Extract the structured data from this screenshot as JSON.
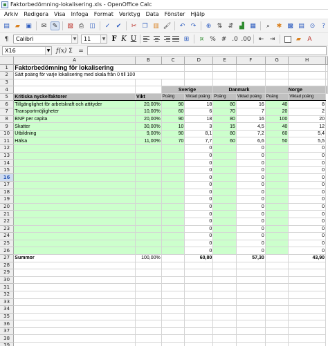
{
  "window": {
    "title": "Faktorbedömning-lokalisering.xls - OpenOffice Calc"
  },
  "menu": [
    "Arkiv",
    "Redigera",
    "Visa",
    "Infoga",
    "Format",
    "Verktyg",
    "Data",
    "Fönster",
    "Hjälp"
  ],
  "toolbar": {
    "font_name": "Calibri",
    "font_size": "11"
  },
  "formula_bar": {
    "cell_ref": "X16",
    "formula": ""
  },
  "columns": [
    "A",
    "B",
    "C",
    "D",
    "E",
    "F",
    "G",
    "H"
  ],
  "sheet": {
    "title": "Faktorbedömning för lokalisering",
    "subtitle": "Sätt poäng för varje lokalisering med skala från 0 till 100",
    "countries": [
      "Sverige",
      "Danmark",
      "Norge"
    ],
    "header": {
      "factor": "Kritiska nyckelfaktorer",
      "weight": "Vikt",
      "points": "Poäng",
      "weighted": "Viktad poäng"
    },
    "rows": [
      {
        "factor": "Tillgänglighet för arbetskraft och attityder",
        "weight": "20,00%",
        "vals": [
          "90",
          "18",
          "80",
          "16",
          "40",
          "8"
        ]
      },
      {
        "factor": "Transportmöjligheter",
        "weight": "10,00%",
        "vals": [
          "60",
          "6",
          "70",
          "7",
          "20",
          "2"
        ]
      },
      {
        "factor": "BNP per capita",
        "weight": "20,00%",
        "vals": [
          "90",
          "18",
          "80",
          "16",
          "100",
          "20"
        ]
      },
      {
        "factor": "Skatter",
        "weight": "30,00%",
        "vals": [
          "10",
          "3",
          "15",
          "4,5",
          "40",
          "12"
        ]
      },
      {
        "factor": "Utbildning",
        "weight": "9,00%",
        "vals": [
          "90",
          "8,1",
          "80",
          "7,2",
          "60",
          "5,4"
        ]
      },
      {
        "factor": "Hälsa",
        "weight": "11,00%",
        "vals": [
          "70",
          "7,7",
          "60",
          "6,6",
          "50",
          "5,5"
        ]
      }
    ],
    "zero": "0",
    "sum_row": {
      "label": "Summor",
      "weight": "100,00%",
      "totals": [
        "60,80",
        "57,30",
        "43,90"
      ]
    }
  }
}
